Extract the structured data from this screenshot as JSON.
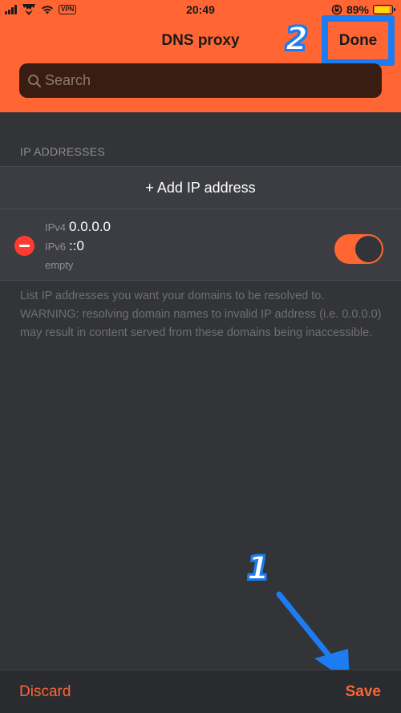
{
  "status_bar": {
    "carrier_icon": "transformers-logo-icon",
    "vpn": "VPN",
    "time": "20:49",
    "battery": "89%",
    "battery_level": 0.89
  },
  "header": {
    "title": "DNS proxy",
    "done_label": "Done",
    "search_placeholder": "Search"
  },
  "annotations": {
    "step_1": "1",
    "step_2": "2"
  },
  "ip_addresses": {
    "section_title": "IP ADDRESSES",
    "add_label": "+ Add IP address",
    "entries": [
      {
        "ipv4_label": "IPv4",
        "ipv4_value": "0.0.0.0",
        "ipv6_label": "IPv6",
        "ipv6_value": "::0",
        "note": "empty",
        "enabled": true
      }
    ],
    "footer": "List IP addresses you want your domains to be resolved to. WARNING: resolving domain names to invalid IP address (i.e. 0.0.0.0) may result in content served from these domains being inaccessible."
  },
  "toolbar": {
    "discard_label": "Discard",
    "save_label": "Save"
  },
  "colors": {
    "accent": "#ff6633",
    "highlight": "#1d7cf2",
    "background": "#333438",
    "delete": "#ff3b30"
  }
}
